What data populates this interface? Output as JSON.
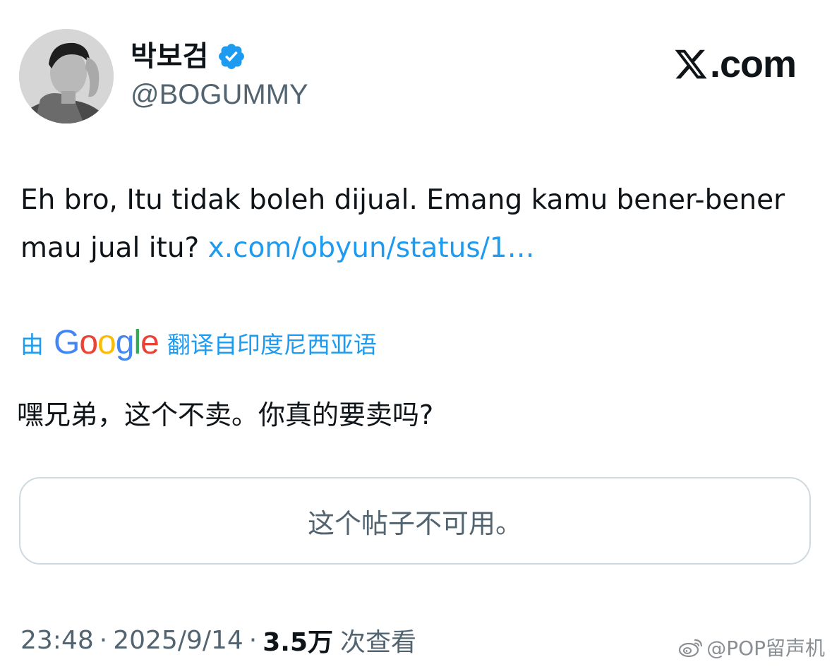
{
  "author": {
    "display_name": "박보검",
    "handle": "@BOGUMMY",
    "verified_icon": "verified-badge-icon",
    "avatar_icon": "profile-photo"
  },
  "site": {
    "logo_text": ".com",
    "logo_icon": "x-logo-icon"
  },
  "tweet": {
    "text": "Eh bro, Itu tidak boleh dijual. Emang kamu bener-bener mau jual itu?",
    "link_text": "x.com/obyun/status/1…"
  },
  "translation": {
    "by_label": "由",
    "provider_logo": "Google",
    "from_label": "翻译自印度尼西亚语",
    "translated_text": "嘿兄弟，这个不卖。你真的要卖吗?"
  },
  "quoted_post": {
    "message": "这个帖子不可用。"
  },
  "meta": {
    "time": "23:48",
    "separator": "·",
    "date": "2025/9/14",
    "views_count": "3.5万",
    "views_label": "次查看"
  },
  "watermark": {
    "text": "@POP留声机",
    "icon": "weibo-icon"
  },
  "colors": {
    "link_blue": "#1d9bf0",
    "secondary_text": "#536471",
    "primary_text": "#0f1419",
    "border": "#cfd9de"
  }
}
